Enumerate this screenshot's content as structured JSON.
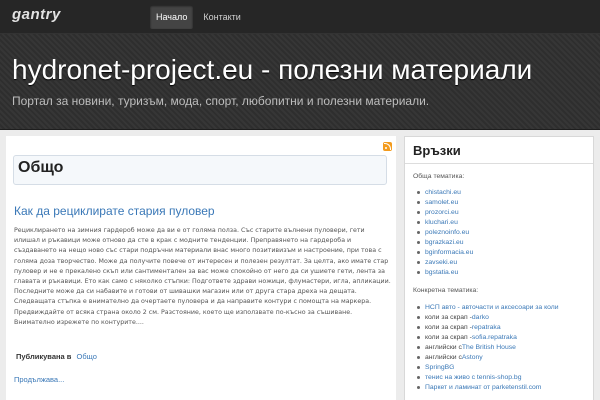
{
  "topbar": {
    "logo": "gantry",
    "nav": [
      {
        "label": "Начало",
        "active": true
      },
      {
        "label": "Контакти",
        "active": false
      }
    ]
  },
  "header": {
    "title": "hydronet-project.eu - полезни материали",
    "tagline": "Портал за новини, туризъм, мода, спорт, любопитни и полезни материали."
  },
  "main": {
    "category": "Общо",
    "post": {
      "title": "Как да рециклирате стария пуловер",
      "body": "Рециклирането на зимния гардероб може да ви е от голяма полза. Със старите вълнени пуловери, гети илишал и ръкавици може отново да сте в крак с модните тенденции. Преправянето на гардероба и създаването на нещо ново със стари подръчни материали внас много позитивизъм и настроение, при това с голяма доза творчество. Може да получите повече от интересен и полезен резултат. За целта, ако имате стар пуловер и не е прекалено скъп или сантиментален за вас може спокойно от него да си ушиете гети, лента за главата и ръкавици. Ето как само с няколко стъпки: Подгответе здрави ножици, флумастери, игла, апликации. Последните може да си набавите и готови от шивашки магазин или от друга стара дреха на дещата. Следващата стъпка е внимателно да очертаете пуловера и да направите контури с помощта на маркера. Предвиждайте от всяка страна около 2 см. Разстояние, което ще използвате по-късно за съшиване. Внимателно изрежете по контурите....",
      "meta_label": "Публикувана в",
      "meta_category": "Общо",
      "read_more": "Продължава..."
    }
  },
  "sidebar": {
    "title": "Връзки",
    "general_label": "Обща тематика:",
    "general_links": [
      "chistachi.eu",
      "samolet.eu",
      "prozorci.eu",
      "kluchari.eu",
      "poleznoinfo.eu",
      "bgrazkazi.eu",
      "bginformacia.eu",
      "zavseki.eu",
      "bgstatia.eu"
    ],
    "specific_label": "Конкретна тематика:",
    "specific_links": [
      {
        "prefix": "",
        "text": "НСП авто - авточасти и аксесоари за коли"
      },
      {
        "prefix": "коли за скрап - ",
        "text": "darko"
      },
      {
        "prefix": "коли за скрап - ",
        "text": "repatraka"
      },
      {
        "prefix": "коли за скрап - ",
        "text": "sofia.repatraka"
      },
      {
        "prefix": "английски с ",
        "text": "The British House"
      },
      {
        "prefix": "английски с ",
        "text": "Astony"
      },
      {
        "prefix": "",
        "text": "SpringBG"
      },
      {
        "prefix": "",
        "text": "тенис на живо с tennis-shop.bg"
      },
      {
        "prefix": "",
        "text": "Паркет и ламинат от parketenstil.com"
      }
    ]
  },
  "colors": {
    "link": "#3a78b7",
    "topbar": "#262626",
    "header": "#333333",
    "rss": "#f39b1d"
  }
}
